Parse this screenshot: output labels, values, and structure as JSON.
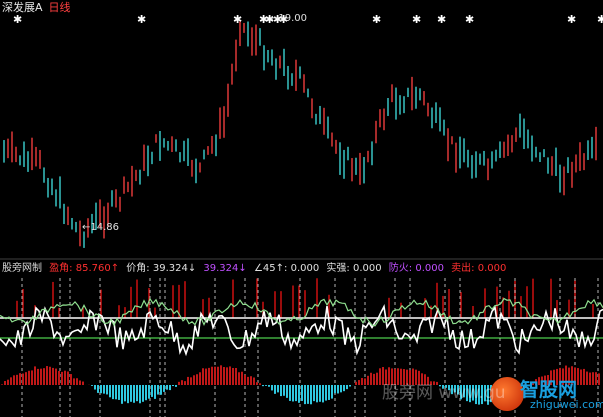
{
  "window": {
    "stock_name": "深发展A",
    "period": "日线"
  },
  "price_chart": {
    "high_label": "19.00",
    "low_label": "14.86",
    "high_arrow": "←",
    "low_arrow": "←"
  },
  "indicator": {
    "name": "股旁网制",
    "yingjiao": "盈角: 85.760↑",
    "jiajiao": "价角: 39.324↓",
    "jiajiao2": "39.324↓",
    "angle45": "∠45↑: 0.000",
    "shiqiang": "实强: 0.000",
    "fanghuo": "防火: 0.000",
    "maichu": "卖出: 0.000"
  },
  "watermark": {
    "text": "股旁网 www.gu",
    "brand": "智股网",
    "url": "zhiguwei.com"
  },
  "colors": {
    "up": "#ff4040",
    "down": "#40e0e0",
    "signal": "#ffffff",
    "grid_line": "#ffffff",
    "green_line": "#60ff60",
    "red_bar": "#c01010",
    "cyan_bar": "#30c8e0"
  }
}
